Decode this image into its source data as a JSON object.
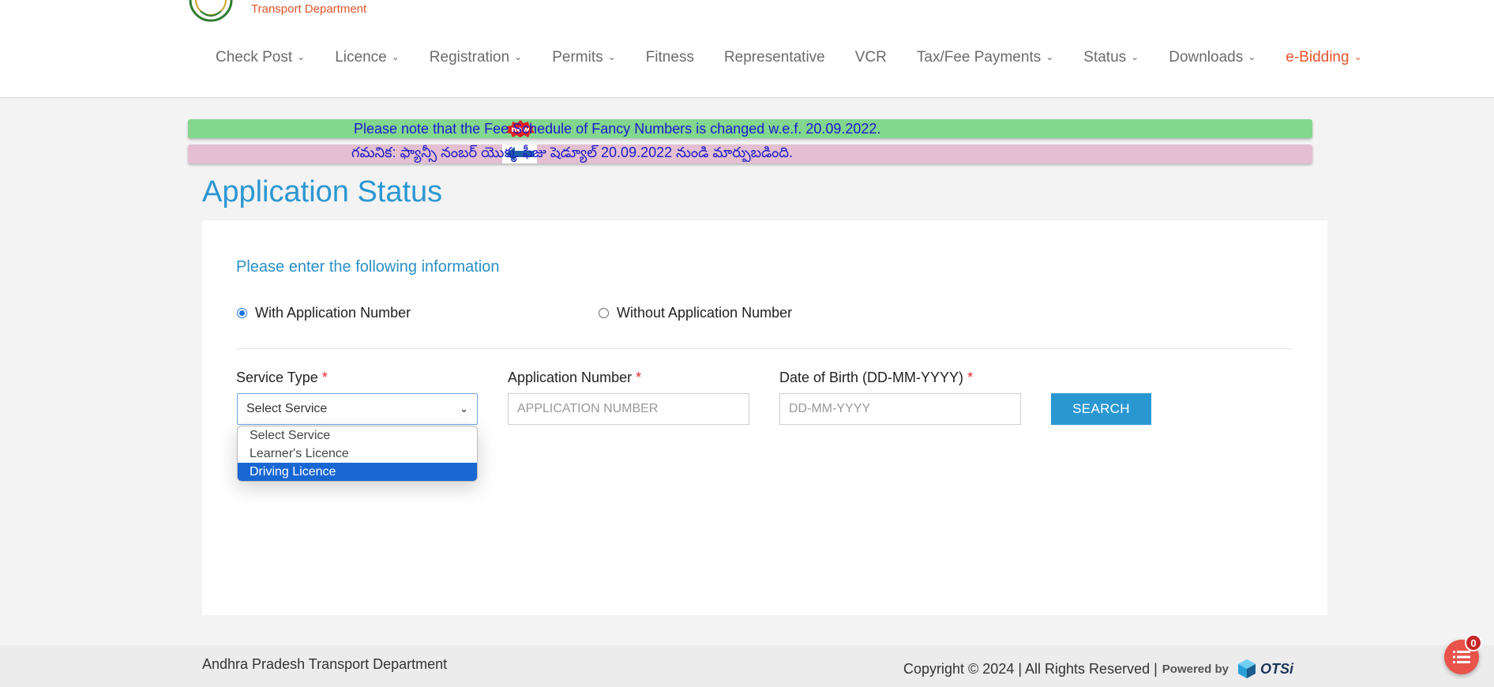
{
  "header": {
    "department": "Transport Department",
    "nav": [
      {
        "label": "Check Post",
        "dropdown": true
      },
      {
        "label": "Licence",
        "dropdown": true
      },
      {
        "label": "Registration",
        "dropdown": true
      },
      {
        "label": "Permits",
        "dropdown": true
      },
      {
        "label": "Fitness",
        "dropdown": false
      },
      {
        "label": "Representative",
        "dropdown": false
      },
      {
        "label": "VCR",
        "dropdown": false
      },
      {
        "label": "Tax/Fee Payments",
        "dropdown": true
      },
      {
        "label": "Status",
        "dropdown": true
      },
      {
        "label": "Downloads",
        "dropdown": true
      },
      {
        "label": "e-Bidding",
        "dropdown": true,
        "accent": true
      }
    ]
  },
  "ticker": {
    "english": "Please note that the Fee Schedule of Fancy Numbers is changed w.e.f. 20.09.2022.",
    "telugu": "గమనిక: ఫ్యాన్సీ నంబర్ యొక్క ఫీజు షెడ్యూల్ 20.09.2022 నుండి మార్పుబడింది.",
    "badge": "new"
  },
  "main": {
    "title": "Application Status",
    "subtitle": "Please enter the following information",
    "radios": [
      {
        "label": "With Application Number",
        "checked": true
      },
      {
        "label": "Without Application Number",
        "checked": false
      }
    ],
    "fields": {
      "service_type": {
        "label": "Service Type",
        "value": "Select Service"
      },
      "application_number": {
        "label": "Application Number",
        "placeholder": "APPLICATION NUMBER"
      },
      "dob": {
        "label": "Date of Birth (DD-MM-YYYY)",
        "placeholder": "DD-MM-YYYY"
      }
    },
    "required_mark": "*",
    "search_label": "SEARCH",
    "dropdown_options": [
      "Select Service",
      "Learner's Licence",
      "Driving Licence"
    ],
    "dropdown_highlighted": "Driving Licence"
  },
  "footer": {
    "left": "Andhra Pradesh Transport Department",
    "copyright": "Copyright © 2024 | All Rights Reserved |",
    "powered_by": "Powered by",
    "brand": "OTSi"
  },
  "fab": {
    "count": "0"
  },
  "colors": {
    "accent_blue": "#2b97d1",
    "accent_orange": "#e8542e",
    "ticker_green": "#82d68e",
    "ticker_pink": "#e3bfd1"
  }
}
